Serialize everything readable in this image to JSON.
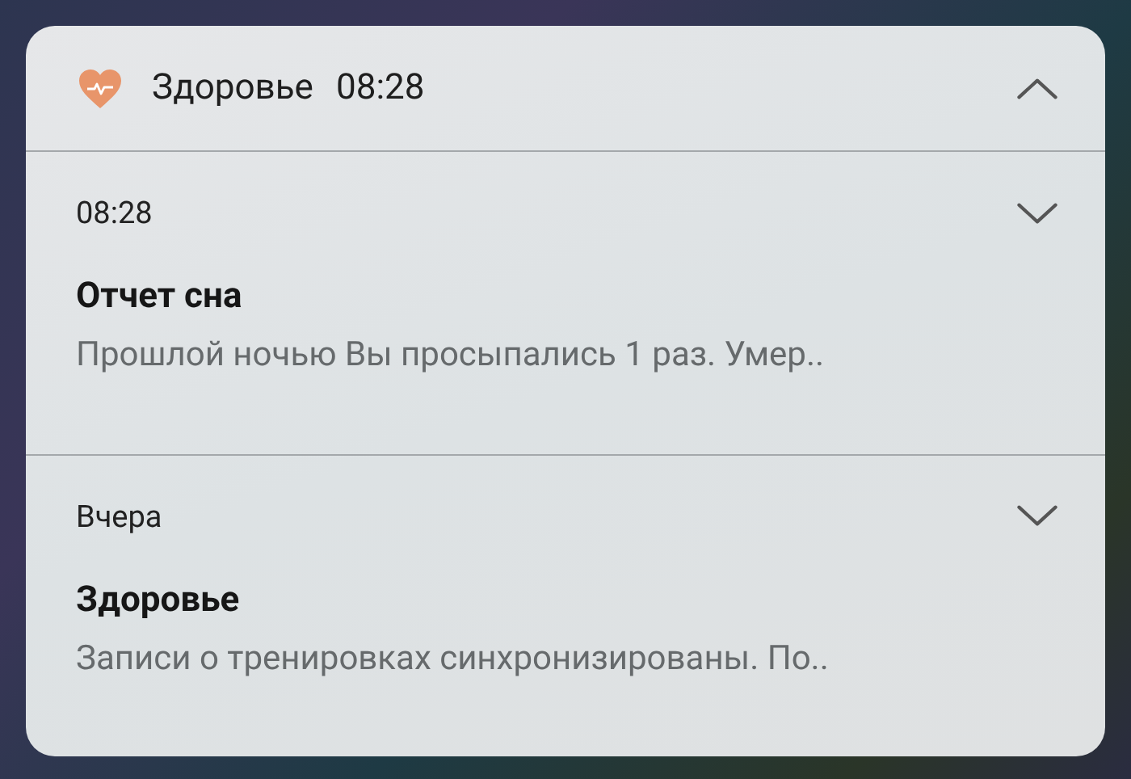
{
  "header": {
    "app_name": "Здоровье",
    "time": "08:28",
    "expanded": true
  },
  "notifications": [
    {
      "time": "08:28",
      "title": "Отчет сна",
      "text": "Прошлой ночью Вы просыпались 1 раз. Умер..",
      "expanded": false
    },
    {
      "time": "Вчера",
      "title": "Здоровье",
      "text": "Записи о тренировках синхронизированы. По..",
      "expanded": false
    }
  ]
}
